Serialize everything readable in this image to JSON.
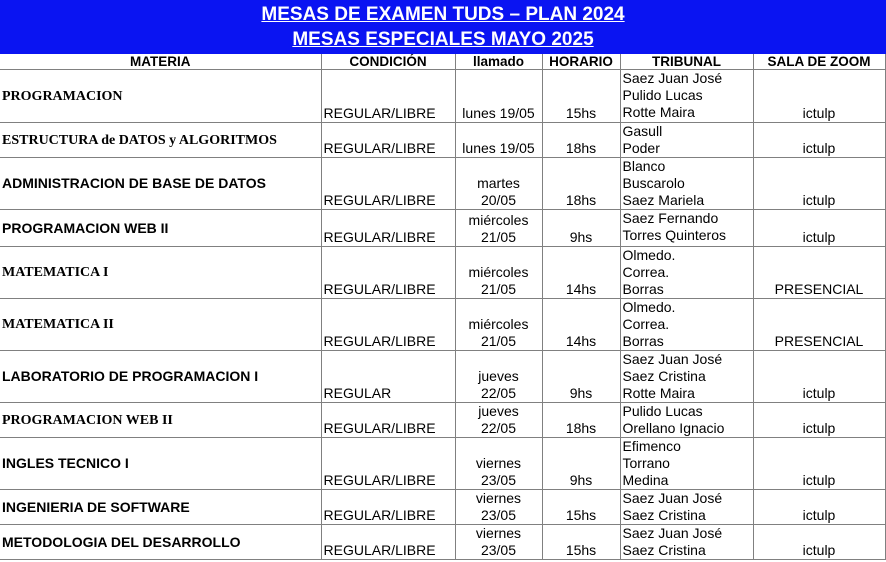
{
  "header": {
    "line1": "MESAS DE EXAMEN TUDS – PLAN 2024",
    "line2": "MESAS ESPECIALES MAYO 2025"
  },
  "columns": {
    "materia": "MATERIA",
    "condicion": "CONDICIÓN",
    "llamado": "llamado",
    "horario": "HORARIO",
    "tribunal": "TRIBUNAL",
    "sala": "SALA DE ZOOM"
  },
  "rows": [
    {
      "materia": "PROGRAMACION",
      "condicion": "REGULAR/LIBRE",
      "llamado": [
        "lunes 19/05"
      ],
      "horario": "15hs",
      "tribunal": [
        "Saez Juan José",
        "Pulido Lucas",
        "Rotte Maira"
      ],
      "sala": "ictulp"
    },
    {
      "materia": "ESTRUCTURA de DATOS y ALGORITMOS",
      "condicion": "REGULAR/LIBRE",
      "llamado": [
        "lunes 19/05"
      ],
      "horario": "18hs",
      "tribunal": [
        "Gasull",
        "Poder"
      ],
      "sala": "ictulp"
    },
    {
      "materia": "ADMINISTRACION DE BASE DE DATOS",
      "condicion": "REGULAR/LIBRE",
      "llamado": [
        "martes",
        "20/05"
      ],
      "horario": "18hs",
      "tribunal": [
        "Blanco",
        "Buscarolo",
        "Saez Mariela"
      ],
      "sala": "ictulp"
    },
    {
      "materia": "PROGRAMACION WEB II",
      "condicion": "REGULAR/LIBRE",
      "llamado": [
        "miércoles",
        "21/05"
      ],
      "horario": "9hs",
      "tribunal": [
        "Saez Fernando",
        "Torres Quinteros"
      ],
      "sala": "ictulp"
    },
    {
      "materia": "MATEMATICA I",
      "condicion": "REGULAR/LIBRE",
      "llamado": [
        "miércoles",
        "21/05"
      ],
      "horario": "14hs",
      "tribunal": [
        "Olmedo.",
        "Correa.",
        "Borras"
      ],
      "sala": "PRESENCIAL"
    },
    {
      "materia": "MATEMATICA II",
      "condicion": "REGULAR/LIBRE",
      "llamado": [
        "miércoles",
        "21/05"
      ],
      "horario": "14hs",
      "tribunal": [
        "Olmedo.",
        "Correa.",
        "Borras"
      ],
      "sala": "PRESENCIAL"
    },
    {
      "materia": "LABORATORIO DE PROGRAMACION I",
      "condicion": "REGULAR",
      "llamado": [
        "jueves",
        "22/05"
      ],
      "horario": "9hs",
      "tribunal": [
        "Saez Juan José",
        "Saez Cristina",
        "Rotte Maira"
      ],
      "sala": "ictulp"
    },
    {
      "materia": "PROGRAMACION WEB II",
      "condicion": "REGULAR/LIBRE",
      "llamado": [
        "jueves",
        "22/05"
      ],
      "horario": "18hs",
      "tribunal": [
        "Pulido Lucas",
        "Orellano Ignacio"
      ],
      "sala": "ictulp"
    },
    {
      "materia": "INGLES TECNICO I",
      "condicion": "REGULAR/LIBRE",
      "llamado": [
        "viernes",
        "23/05"
      ],
      "horario": "9hs",
      "tribunal": [
        "Efimenco",
        "Torrano",
        "Medina"
      ],
      "sala": "ictulp"
    },
    {
      "materia": "INGENIERIA DE SOFTWARE",
      "condicion": "REGULAR/LIBRE",
      "llamado": [
        "viernes",
        "23/05"
      ],
      "horario": "15hs",
      "tribunal": [
        "Saez Juan José",
        "Saez Cristina"
      ],
      "sala": "ictulp"
    },
    {
      "materia": "METODOLOGIA DEL DESARROLLO",
      "condicion": "REGULAR/LIBRE",
      "llamado": [
        "viernes",
        "23/05"
      ],
      "horario": "15hs",
      "tribunal": [
        "Saez Juan José",
        "Saez Cristina"
      ],
      "sala": "ictulp"
    }
  ]
}
